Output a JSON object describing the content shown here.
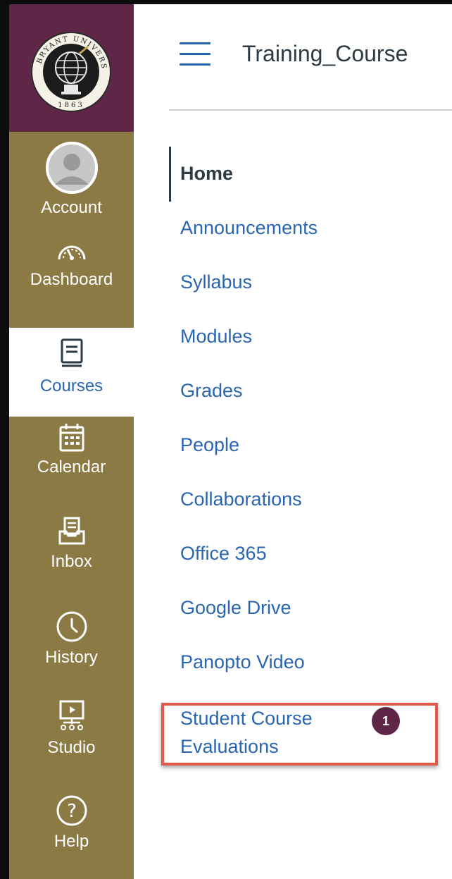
{
  "logo": {
    "university_text": "BRYANT UNIVERSITY",
    "year": "1863"
  },
  "global_nav": {
    "items": [
      {
        "label": "Account",
        "icon": "account-avatar-icon"
      },
      {
        "label": "Dashboard",
        "icon": "dashboard-gauge-icon"
      },
      {
        "label": "Courses",
        "icon": "courses-book-icon",
        "active": true
      },
      {
        "label": "Calendar",
        "icon": "calendar-icon"
      },
      {
        "label": "Inbox",
        "icon": "inbox-tray-icon"
      },
      {
        "label": "History",
        "icon": "history-clock-icon"
      },
      {
        "label": "Studio",
        "icon": "studio-screen-icon"
      },
      {
        "label": "Help",
        "icon": "help-question-icon"
      }
    ]
  },
  "header": {
    "course_title": "Training_Course"
  },
  "course_nav": {
    "items": [
      {
        "label": "Home",
        "active": true
      },
      {
        "label": "Announcements"
      },
      {
        "label": "Syllabus"
      },
      {
        "label": "Modules"
      },
      {
        "label": "Grades"
      },
      {
        "label": "People"
      },
      {
        "label": "Collaborations"
      },
      {
        "label": "Office 365"
      },
      {
        "label": "Google Drive"
      },
      {
        "label": "Panopto Video"
      },
      {
        "label_line1": "Student Course",
        "label_line2": "Evaluations",
        "badge": "1"
      }
    ]
  },
  "colors": {
    "brand_purple": "#5f2648",
    "nav_gold": "#8c7a45",
    "link_blue": "#2a66b0",
    "highlight_red": "#e2584b",
    "text_dark": "#2d3b45"
  }
}
